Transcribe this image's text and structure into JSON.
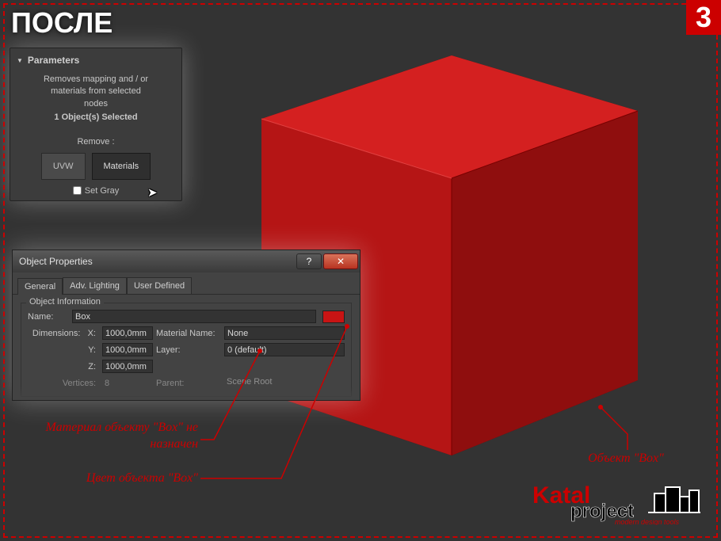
{
  "overlay": {
    "title": "ПОСЛЕ",
    "step": "3"
  },
  "params": {
    "header": "Parameters",
    "desc1": "Removes mapping and / or",
    "desc2": "materials from selected",
    "desc3": "nodes",
    "selected": "1 Object(s) Selected",
    "remove_label": "Remove :",
    "btn_uvw": "UVW",
    "btn_materials": "Materials",
    "set_gray": "Set Gray"
  },
  "dialog": {
    "title": "Object Properties",
    "help": "?",
    "close": "✕",
    "tabs": {
      "general": "General",
      "adv": "Adv. Lighting",
      "user": "User Defined"
    },
    "group": "Object Information",
    "name_label": "Name:",
    "name_value": "Box",
    "dim_label": "Dimensions:",
    "x_label": "X:",
    "x_value": "1000,0mm",
    "y_label": "Y:",
    "y_value": "1000,0mm",
    "z_label": "Z:",
    "z_value": "1000,0mm",
    "vertices_label": "Vertices:",
    "vertices_value": "8",
    "material_label": "Material Name:",
    "material_value": "None",
    "layer_label": "Layer:",
    "layer_value": "0 (default)",
    "parent_label": "Parent:",
    "parent_value": "Scene Root"
  },
  "annotations": {
    "material": "Материал объекту \"Box\" не назначен",
    "color": "Цвет объекта \"Box\"",
    "object": "Объект \"Box\""
  },
  "logo": {
    "brand1": "Katal",
    "brand2": "project",
    "tagline": "modern design tools"
  }
}
